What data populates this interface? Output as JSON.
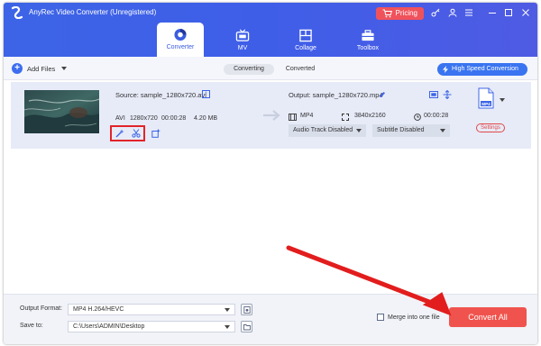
{
  "app": {
    "title": "AnyRec Video Converter (Unregistered)"
  },
  "header": {
    "pricing_label": "Pricing",
    "nav_tabs": [
      {
        "label": "Converter",
        "icon": "converter-disc-icon",
        "active": true
      },
      {
        "label": "MV",
        "icon": "tv-icon",
        "active": false
      },
      {
        "label": "Collage",
        "icon": "collage-grid-icon",
        "active": false
      },
      {
        "label": "Toolbox",
        "icon": "toolbox-icon",
        "active": false
      }
    ]
  },
  "toolbar": {
    "add_files_label": "Add Files",
    "tabs": [
      {
        "label": "Converting",
        "active": true
      },
      {
        "label": "Converted",
        "active": false
      }
    ],
    "high_speed_label": "High Speed Conversion"
  },
  "file": {
    "source_label": "Source: sample_1280x720.avi",
    "format": "AVI",
    "resolution": "1280x720",
    "duration": "00:00:28",
    "size": "4.20 MB",
    "output_label": "Output: sample_1280x720.mp4",
    "output_format": "MP4",
    "output_resolution": "3840x2160",
    "output_duration": "00:00:28",
    "audio_track": "Audio Track Disabled",
    "subtitle": "Subtitle Disabled",
    "format_badge": "MP4",
    "settings_label": "Settings"
  },
  "bottom": {
    "output_format_label": "Output Format:",
    "output_format_value": "MP4 H.264/HEVC",
    "save_to_label": "Save to:",
    "save_to_value": "C:\\Users\\ADMIN\\Desktop",
    "merge_label": "Merge into one file",
    "convert_all_label": "Convert All"
  },
  "colors": {
    "header_blue": "#3f5ee8",
    "accent_blue": "#3a74f0",
    "convert_red": "#f0534d",
    "highlight_red": "#e2242b"
  }
}
